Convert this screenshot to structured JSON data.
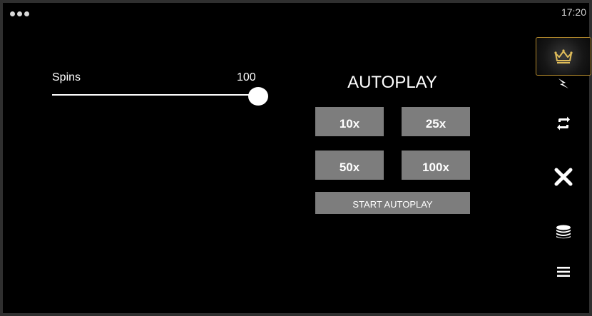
{
  "status_bar": {
    "time": "17:20"
  },
  "spins": {
    "label": "Spins",
    "value": "100",
    "level": 1.0
  },
  "autoplay": {
    "title": "AUTOPLAY",
    "options": [
      "10x",
      "25x",
      "50x",
      "100x"
    ],
    "start_label": "START AUTOPLAY"
  },
  "sidebar": {
    "icons": [
      "crown-icon",
      "turbo-lightning-icon",
      "autoplay-icon",
      "close-icon",
      "coins-icon",
      "menu-icon"
    ]
  },
  "colors": {
    "background": "#000000",
    "button": "#7d7d7d",
    "crown_gold": "#e0bd5a",
    "crown_border": "#b48a2c"
  }
}
